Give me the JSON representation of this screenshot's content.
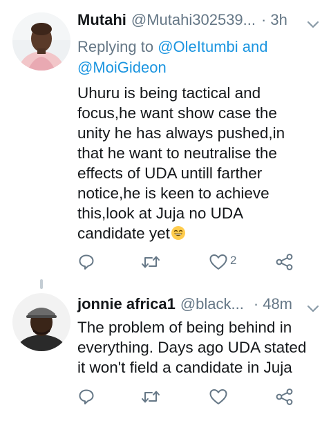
{
  "tweets": [
    {
      "name": "Mutahi",
      "handle": "@Mutahi302539...",
      "time": "3h",
      "replying_prefix": "Replying to ",
      "replying_mentions": [
        "@OleItumbi",
        " and",
        "@MoiGideon"
      ],
      "body_lines": [
        "Uhuru is being tactical and",
        "focus,he want show case the",
        "unity he has always pushed,in",
        "that he want to neutralise the",
        "effects of UDA untill farther",
        "notice,he is keen to achieve",
        "this,look at Juja no UDA",
        "candidate yet"
      ],
      "emoji": "grinning-face",
      "like_count": "2"
    },
    {
      "name": "jonnie africa1",
      "handle": "@black...",
      "time": "48m",
      "body_lines": [
        "The problem of being behind in",
        "everything. Days ago UDA stated",
        "it won't field a candidate in Juja"
      ],
      "like_count": ""
    }
  ],
  "icons": [
    "reply-icon",
    "retweet-icon",
    "like-icon",
    "share-icon",
    "chevron-down-icon"
  ],
  "colors": {
    "gray": "#657786",
    "link": "#1b95e0",
    "text": "#14171a"
  }
}
